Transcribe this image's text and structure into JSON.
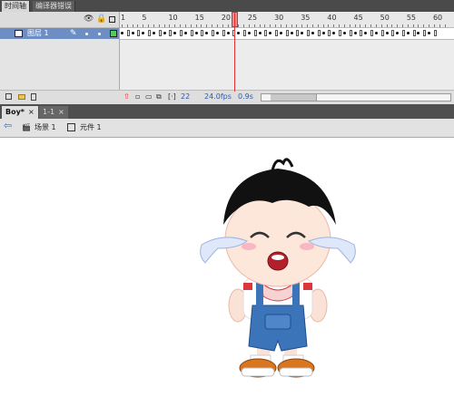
{
  "panel_tabs": [
    {
      "label": "时间轴",
      "active": true
    },
    {
      "label": "编译器错误",
      "active": false
    }
  ],
  "timeline": {
    "ruler_labels": [
      "1",
      "5",
      "10",
      "15",
      "20",
      "25",
      "30",
      "35",
      "40",
      "45",
      "50",
      "55",
      "60"
    ],
    "layer": {
      "name": "图层 1"
    },
    "current_frame": "22",
    "fps": "24.0fps",
    "time": "0.9s"
  },
  "doc_tabs": [
    {
      "label": "Boy*",
      "close": "×",
      "active": true
    },
    {
      "label": "1-1",
      "close": "×",
      "active": false
    }
  ],
  "edit_bar": {
    "scene": "场景 1",
    "symbol": "元件 1"
  },
  "colors": {
    "layer_selected": "#6c8ec4",
    "layer_color": "#4fce4f",
    "playhead": "#d33333",
    "shirt_stripe": "#d9363e",
    "overalls": "#3b74b9",
    "hair": "#111111",
    "shoes": "#d9761f"
  },
  "icons": [
    "eye-icon",
    "lock-icon",
    "outline-icon",
    "pencil-icon",
    "new-layer-icon",
    "new-folder-icon",
    "delete-icon",
    "back-arrow-icon",
    "scene-icon",
    "symbol-icon"
  ]
}
